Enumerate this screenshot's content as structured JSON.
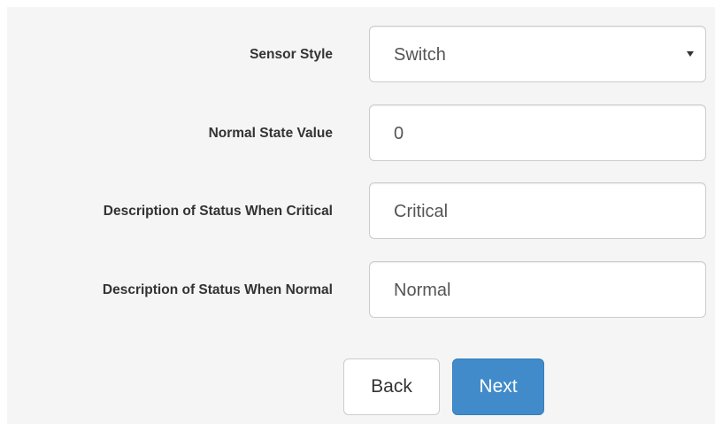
{
  "form": {
    "fields": [
      {
        "label": "Sensor Style",
        "value": "Switch",
        "type": "select"
      },
      {
        "label": "Normal State Value",
        "value": "0",
        "type": "text"
      },
      {
        "label": "Description of Status When Critical",
        "value": "Critical",
        "type": "text"
      },
      {
        "label": "Description of Status When Normal",
        "value": "Normal",
        "type": "text"
      }
    ]
  },
  "actions": {
    "back_label": "Back",
    "next_label": "Next"
  },
  "colors": {
    "panel_background": "#f5f5f5",
    "primary_button": "#428bca",
    "label_text": "#333333",
    "input_text": "#555555"
  }
}
